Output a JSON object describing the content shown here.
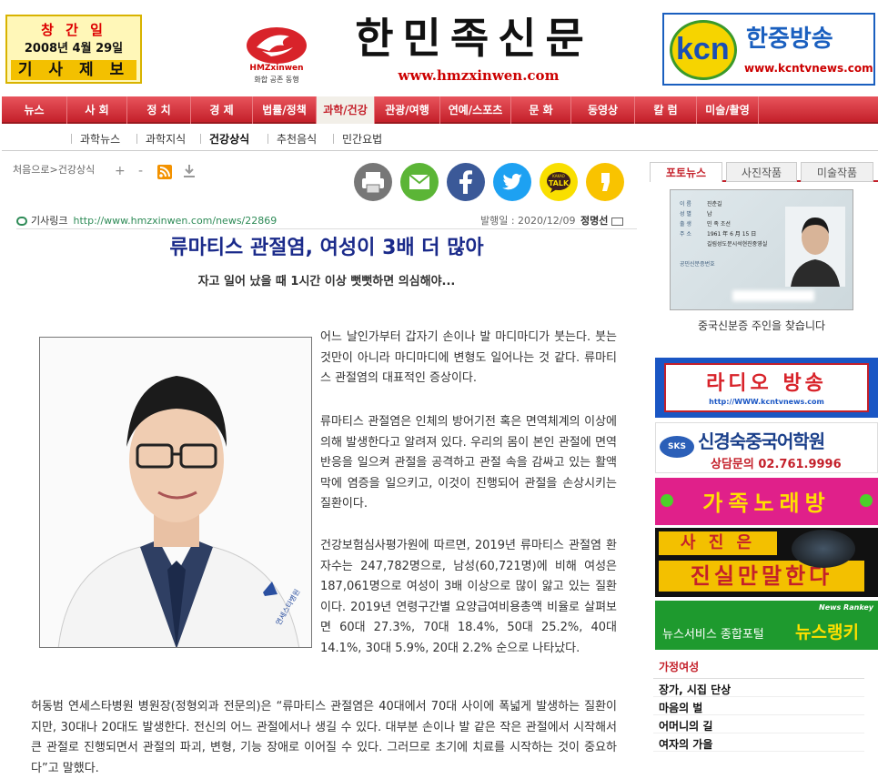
{
  "header": {
    "date_box": {
      "line1": "창 간 일",
      "line2": "2008년 4월 29일",
      "line3": "기 사 제 보"
    },
    "logo_small": {
      "text": "HMZxinwen",
      "tagline": "화합 공존 동행"
    },
    "masthead_title": "한민족신문",
    "site_url": "www.hmzxinwen.com",
    "partner_banner": {
      "logo_text": "kcn",
      "name": "한중방송",
      "url": "www.kcntvnews.com"
    }
  },
  "nav": {
    "items": [
      "뉴스",
      "사 회",
      "정 치",
      "경 제",
      "법률/정책",
      "과학/건강",
      "관광/여행",
      "연예/스포츠",
      "문 화",
      "동영상",
      "칼 럼",
      "미술/촬영"
    ],
    "active": "과학/건강"
  },
  "subnav": {
    "items": [
      "과학뉴스",
      "과학지식",
      "건강상식",
      "추천음식",
      "민간요법"
    ],
    "active": "건강상식"
  },
  "breadcrumb": {
    "home": "처음으로",
    "sep": ">",
    "current": "건강상식"
  },
  "toolbar": {
    "zoom_in": "+",
    "zoom_out": "-"
  },
  "share_icons": [
    "print-icon",
    "email-icon",
    "facebook-icon",
    "twitter-icon",
    "kakaotalk-icon",
    "kakaostory-icon"
  ],
  "share_labels": {
    "kakaotalk_small": "KAKAO",
    "kakaotalk": "TALK"
  },
  "article_meta": {
    "link_label": "기사링크",
    "link_url": "http://www.hmzxinwen.com/news/22869",
    "date": "발행일 : 2020/12/09",
    "author": "정명선"
  },
  "article": {
    "headline": "류마티스 관절염, 여성이 3배 더 많아",
    "subheadline": "자고 일어 났을 때 1시간 이상 뻣뻣하면 의심해야...",
    "paragraphs": [
      "어느 날인가부터 갑자기 손이나 발 마디마디가 붓는다. 붓는 것만이 아니라 마디마디에 변형도 일어나는 것 같다. 류마티스 관절염의 대표적인 증상이다.",
      "류마티스 관절염은 인체의 방어기전 혹은 면역체계의 이상에 의해 발생한다고 알려져 있다. 우리의 몸이 본인 관절에 면역 반응을 일으켜 관절을 공격하고 관절 속을 감싸고 있는 활액막에 염증을 일으키고, 이것이 진행되어 관절을 손상시키는 질환이다.",
      "건강보험심사평가원에 따르면, 2019년 류마티스 관절염 환자수는 247,782명으로, 남성(60,721명)에 비해 여성은 187,061명으로 여성이 3배 이상으로 많이 앓고 있는 질환이다. 2019년 연령구간별 요양급여비용총액 비율로 살펴보면 60대 27.3%, 70대 18.4%, 50대 25.2%, 40대 14.1%, 30대 5.9%, 20대 2.2% 순으로 나타났다.",
      "허동범 연세스타병원 병원장(정형외과 전문의)은 “류마티스 관절염은 40대에서 70대 사이에 폭넓게 발생하는 질환이지만, 30대나 20대도 발생한다. 전신의 어느 관절에서나 생길 수 있다. 대부분 손이나 발 같은 작은 관절에서 시작해서 큰 관절로 진행되면서 관절의 파괴, 변형, 기능 장애로 이어질 수 있다. 그러므로 초기에 치료를 시작하는 것이 중요하다”고 말했다."
    ],
    "photo_caption_text": "연세스타병원"
  },
  "sidebar": {
    "tabs": [
      "포토뉴스",
      "사진작품",
      "미술작품"
    ],
    "active_tab": "포토뉴스",
    "photo_caption": "중국신분증 주인을 찾습니다",
    "id_card_fields": [
      "이 름",
      "성 별",
      "출 생",
      "주 소",
      "공민신분증번호"
    ],
    "id_card_values": [
      "진춘길",
      "남",
      "민 족  조선",
      "1961 年 6 月 15 日",
      "길림성도문시석현진중영실"
    ],
    "banners": [
      {
        "name": "radio-banner",
        "text": "라디오 방송",
        "sub": "http://WWW.kcntvnews.com"
      },
      {
        "name": "academy-banner",
        "text": "신경숙중국어학원",
        "sub": "상담문의   02.761.9996",
        "tag": "SKS"
      },
      {
        "name": "karaoke-banner",
        "text": "가족노래방"
      },
      {
        "name": "photo-banner",
        "line1": "사 진 은",
        "line2": "진실만말한다"
      },
      {
        "name": "newsranking-banner",
        "text": "뉴스서비스 종합포털",
        "brand": "뉴스랭키",
        "tag": "News Rankey"
      }
    ],
    "list_title": "가정여성",
    "list_items": [
      "장가, 시집 단상",
      "마음의 벌",
      "어머니의 길",
      "여자의 가을"
    ]
  }
}
